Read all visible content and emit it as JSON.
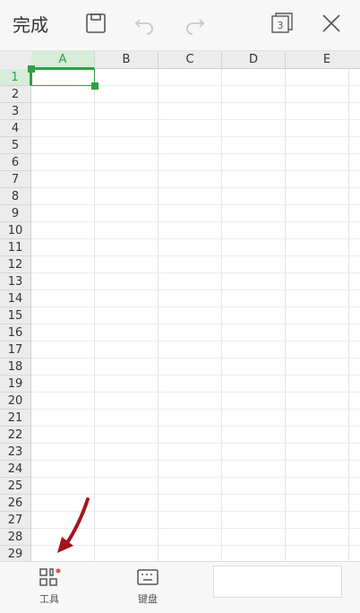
{
  "toolbar": {
    "done_label": "完成",
    "sheet_count": "3"
  },
  "sheet": {
    "columns": [
      "A",
      "B",
      "C",
      "D",
      "E"
    ],
    "rows": [
      "1",
      "2",
      "3",
      "4",
      "5",
      "6",
      "7",
      "8",
      "9",
      "10",
      "11",
      "12",
      "13",
      "14",
      "15",
      "16",
      "17",
      "18",
      "19",
      "20",
      "21",
      "22",
      "23",
      "24",
      "25",
      "26",
      "27",
      "28",
      "29"
    ],
    "selected_cell": "A1",
    "accent_color": "#2f9e47"
  },
  "bottom_bar": {
    "tools_label": "工具",
    "keyboard_label": "键盘",
    "formula_value": ""
  },
  "annotation": {
    "arrow_color": "#a5151c"
  }
}
